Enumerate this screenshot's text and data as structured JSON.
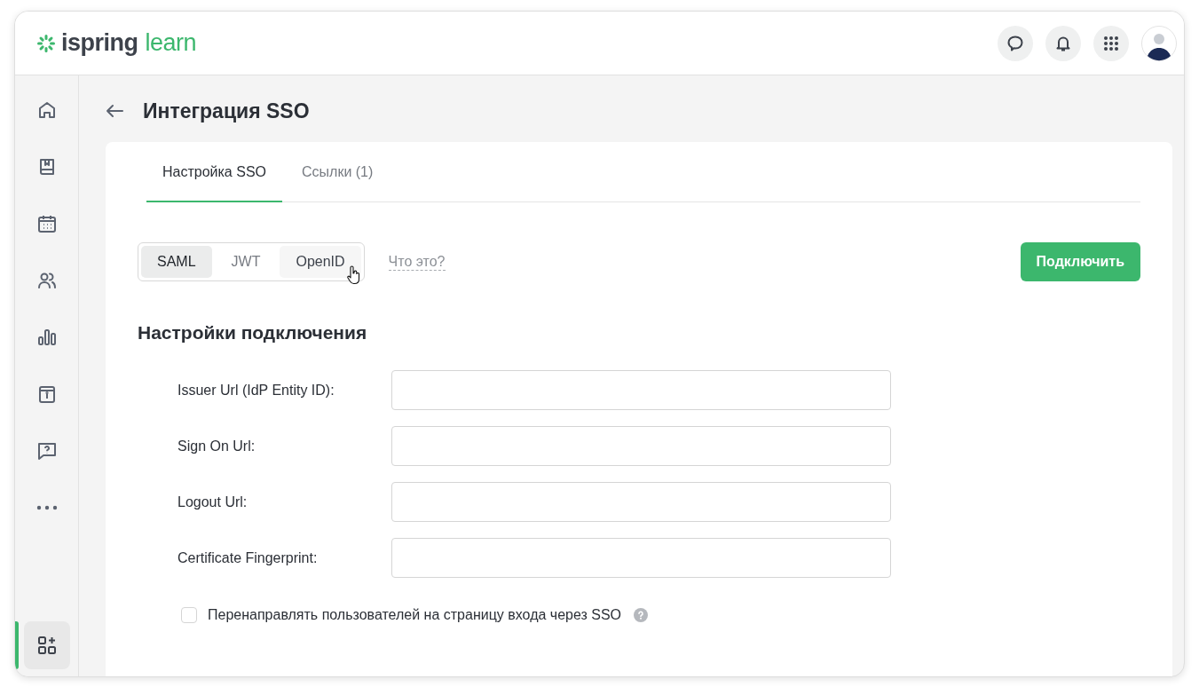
{
  "header": {
    "logo": {
      "brand": "ispring",
      "product": "learn"
    },
    "actions": [
      {
        "kind": "chat"
      },
      {
        "kind": "bell"
      },
      {
        "kind": "apps"
      }
    ]
  },
  "sidebar": {
    "items": [
      {
        "kind": "home",
        "selected": false
      },
      {
        "kind": "book",
        "selected": false
      },
      {
        "kind": "calendar",
        "selected": false
      },
      {
        "kind": "users",
        "selected": false
      },
      {
        "kind": "chart",
        "selected": false
      },
      {
        "kind": "info",
        "selected": false
      },
      {
        "kind": "question",
        "selected": false
      },
      {
        "kind": "more",
        "selected": false
      }
    ],
    "bottom_item": {
      "kind": "add-apps",
      "selected": true
    }
  },
  "page": {
    "title": "Интеграция SSO"
  },
  "tabs": [
    {
      "label": "Настройка SSO",
      "selected": true
    },
    {
      "label": "Ссылки (1)",
      "selected": false
    }
  ],
  "protocols": [
    {
      "label": "SAML",
      "selected": true,
      "hovered": false
    },
    {
      "label": "JWT",
      "selected": false,
      "hovered": false
    },
    {
      "label": "OpenID",
      "selected": false,
      "hovered": true
    }
  ],
  "help_link": "Что это?",
  "connect_button": "Подключить",
  "section_title": "Настройки подключения",
  "fields": [
    {
      "label": "Issuer Url (IdP Entity ID):"
    },
    {
      "label": "Sign On Url:"
    },
    {
      "label": "Logout Url:"
    },
    {
      "label": "Certificate Fingerprint:"
    }
  ],
  "redirect_option": {
    "label": "Перенаправлять пользователей на страницу входа через SSO",
    "checked": false
  }
}
